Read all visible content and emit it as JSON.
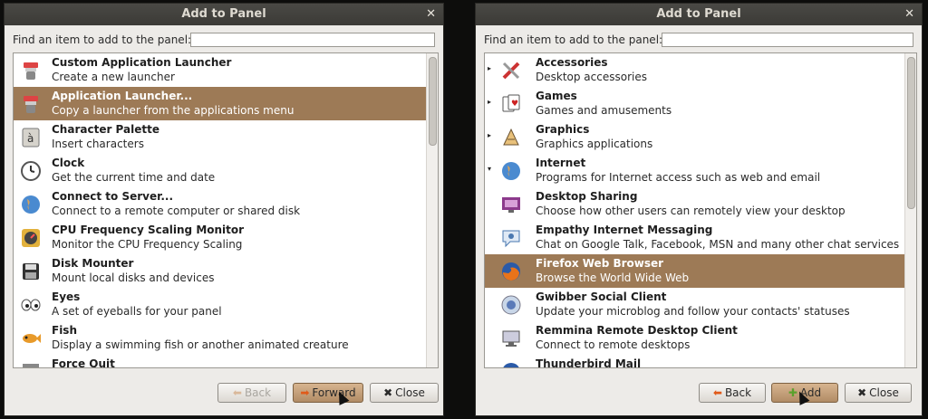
{
  "left": {
    "title": "Add to Panel",
    "find_label": "Find an item to add to the panel:",
    "find_value": "",
    "items": [
      {
        "name": "Custom Application Launcher",
        "desc": "Create a new launcher",
        "icon": "launcher-icon"
      },
      {
        "name": "Application Launcher...",
        "desc": "Copy a launcher from the applications menu",
        "icon": "launcher-icon",
        "selected": true
      },
      {
        "name": "Character Palette",
        "desc": "Insert characters",
        "icon": "character-palette-icon"
      },
      {
        "name": "Clock",
        "desc": "Get the current time and date",
        "icon": "clock-icon"
      },
      {
        "name": "Connect to Server...",
        "desc": "Connect to a remote computer or shared disk",
        "icon": "globe-icon"
      },
      {
        "name": "CPU Frequency Scaling Monitor",
        "desc": "Monitor the CPU Frequency Scaling",
        "icon": "cpu-monitor-icon"
      },
      {
        "name": "Disk Mounter",
        "desc": "Mount local disks and devices",
        "icon": "floppy-disk-icon"
      },
      {
        "name": "Eyes",
        "desc": "A set of eyeballs for your panel",
        "icon": "eyes-icon"
      },
      {
        "name": "Fish",
        "desc": "Display a swimming fish or another animated creature",
        "icon": "fish-icon"
      },
      {
        "name": "Force Quit",
        "desc": "",
        "icon": "force-quit-icon"
      }
    ],
    "buttons": {
      "back": "Back",
      "forward": "Forward",
      "close": "Close"
    }
  },
  "right": {
    "title": "Add to Panel",
    "find_label": "Find an item to add to the panel:",
    "find_value": "",
    "items": [
      {
        "name": "Accessories",
        "desc": "Desktop accessories",
        "icon": "accessories-icon",
        "expander": "▸"
      },
      {
        "name": "Games",
        "desc": "Games and amusements",
        "icon": "games-icon",
        "expander": "▸"
      },
      {
        "name": "Graphics",
        "desc": "Graphics applications",
        "icon": "graphics-icon",
        "expander": "▸"
      },
      {
        "name": "Internet",
        "desc": "Programs for Internet access such as web and email",
        "icon": "internet-icon",
        "expander": "▾"
      },
      {
        "name": "Desktop Sharing",
        "desc": "Choose how other users can remotely view your desktop",
        "icon": "desktop-sharing-icon"
      },
      {
        "name": "Empathy Internet Messaging",
        "desc": "Chat on Google Talk, Facebook, MSN and many other chat services",
        "icon": "chat-icon"
      },
      {
        "name": "Firefox Web Browser",
        "desc": "Browse the World Wide Web",
        "icon": "firefox-icon",
        "selected": true
      },
      {
        "name": "Gwibber Social Client",
        "desc": "Update your microblog and follow your contacts' statuses",
        "icon": "gwibber-icon"
      },
      {
        "name": "Remmina Remote Desktop Client",
        "desc": "Connect to remote desktops",
        "icon": "remote-desktop-icon"
      },
      {
        "name": "Thunderbird Mail",
        "desc": "",
        "icon": "mail-icon"
      }
    ],
    "buttons": {
      "back": "Back",
      "add": "Add",
      "close": "Close"
    }
  },
  "colors": {
    "selection": "#9d7a56",
    "titlebar": "#3b3a36",
    "dialog_bg": "#edebe8"
  }
}
